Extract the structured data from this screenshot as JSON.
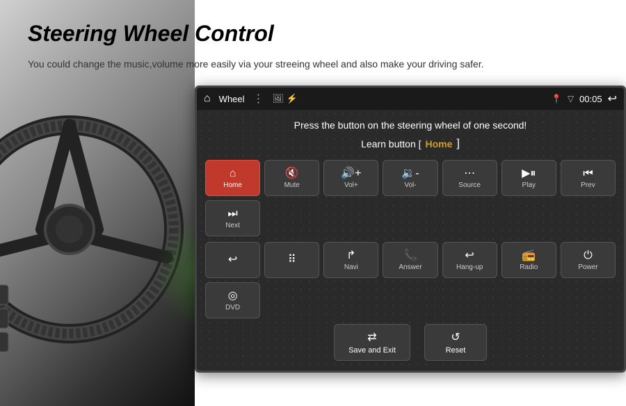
{
  "title": "Steering Wheel Control",
  "description": "You could change the music,volume more easily via your streeing wheel and also make your driving safer.",
  "statusBar": {
    "label": "Wheel",
    "time": "00:05"
  },
  "screen": {
    "instruction": "Press the button on the steering wheel of one second!",
    "learnButtonLabel": "Learn button [",
    "learnButtonCurrent": "Home",
    "learnButtonBracketClose": "]"
  },
  "buttons": {
    "row1": [
      {
        "icon": "⌂",
        "label": "Home",
        "active": true
      },
      {
        "icon": "◁×",
        "label": "Mute",
        "active": false
      },
      {
        "icon": "◁+",
        "label": "Vol+",
        "active": false
      },
      {
        "icon": "◁-",
        "label": "Vol-",
        "active": false
      },
      {
        "icon": "⋯",
        "label": "Source",
        "active": false
      },
      {
        "icon": "▶⏸",
        "label": "Play",
        "active": false
      },
      {
        "icon": "⏮",
        "label": "Prev",
        "active": false
      },
      {
        "icon": "⏭",
        "label": "Next",
        "active": false
      }
    ],
    "row2": [
      {
        "icon": "↺",
        "label": "",
        "active": false
      },
      {
        "icon": "⋮⋮",
        "label": "",
        "active": false
      },
      {
        "icon": "↱",
        "label": "Navi",
        "active": false
      },
      {
        "icon": "☎",
        "label": "Answer",
        "active": false
      },
      {
        "icon": "↩",
        "label": "Hang-up",
        "active": false
      },
      {
        "icon": "▦",
        "label": "Radio",
        "active": false
      },
      {
        "icon": "⏻",
        "label": "Power",
        "active": false
      },
      {
        "icon": "◎",
        "label": "DVD",
        "active": false
      }
    ]
  },
  "actionButtons": [
    {
      "icon": "⇄",
      "label": "Save and Exit"
    },
    {
      "icon": "↺",
      "label": "Reset"
    }
  ]
}
